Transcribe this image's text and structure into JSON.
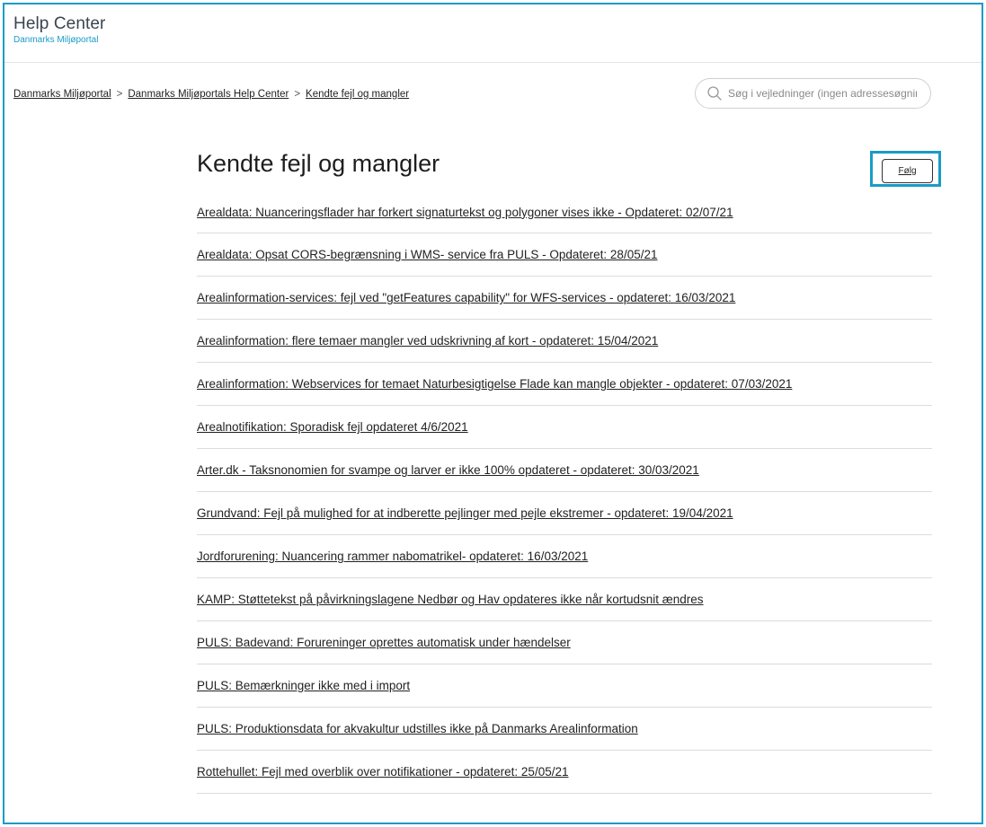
{
  "header": {
    "title": "Help Center",
    "subtitle": "Danmarks Miljøportal"
  },
  "breadcrumb": [
    {
      "label": "Danmarks Miljøportal"
    },
    {
      "label": "Danmarks Miljøportals Help Center"
    },
    {
      "label": "Kendte fejl og mangler"
    }
  ],
  "breadcrumb_separator": ">",
  "search": {
    "placeholder": "Søg i vejledninger (ingen adressesøgning)",
    "value": "",
    "icon": "search-icon"
  },
  "page": {
    "title": "Kendte fejl og mangler",
    "follow_label": "Følg"
  },
  "articles": [
    {
      "title": "Arealdata: Nuanceringsflader har forkert signaturtekst og polygoner vises ikke - Opdateret: 02/07/21"
    },
    {
      "title": "Arealdata: Opsat CORS-begrænsning i WMS- service fra PULS - Opdateret: 28/05/21"
    },
    {
      "title": "Arealinformation-services: fejl ved \"getFeatures capability\" for WFS-services - opdateret: 16/03/2021"
    },
    {
      "title": "Arealinformation: flere temaer mangler ved udskrivning af kort - opdateret: 15/04/2021"
    },
    {
      "title": "Arealinformation: Webservices for temaet Naturbesigtigelse Flade kan mangle objekter - opdateret: 07/03/2021"
    },
    {
      "title": "Arealnotifikation: Sporadisk fejl opdateret 4/6/2021"
    },
    {
      "title": "Arter.dk - Taksnonomien for svampe og larver er ikke 100% opdateret - opdateret: 30/03/2021"
    },
    {
      "title": "Grundvand: Fejl på mulighed for at indberette pejlinger med pejle ekstremer - opdateret: 19/04/2021"
    },
    {
      "title": "Jordforurening: Nuancering rammer nabomatrikel- opdateret: 16/03/2021"
    },
    {
      "title": "KAMP: Støttetekst på påvirkningslagene Nedbør og Hav opdateres ikke når kortudsnit ændres"
    },
    {
      "title": "PULS: Badevand: Forureninger oprettes automatisk under hændelser"
    },
    {
      "title": "PULS: Bemærkninger ikke med i import"
    },
    {
      "title": "PULS: Produktionsdata for akvakultur udstilles ikke på Danmarks Arealinformation"
    },
    {
      "title": "Rottehullet: Fejl med overblik over notifikationer - opdateret: 25/05/21"
    }
  ],
  "colors": {
    "accent": "#1a9bc6",
    "text": "#222222",
    "divider": "#dcdcdc"
  }
}
